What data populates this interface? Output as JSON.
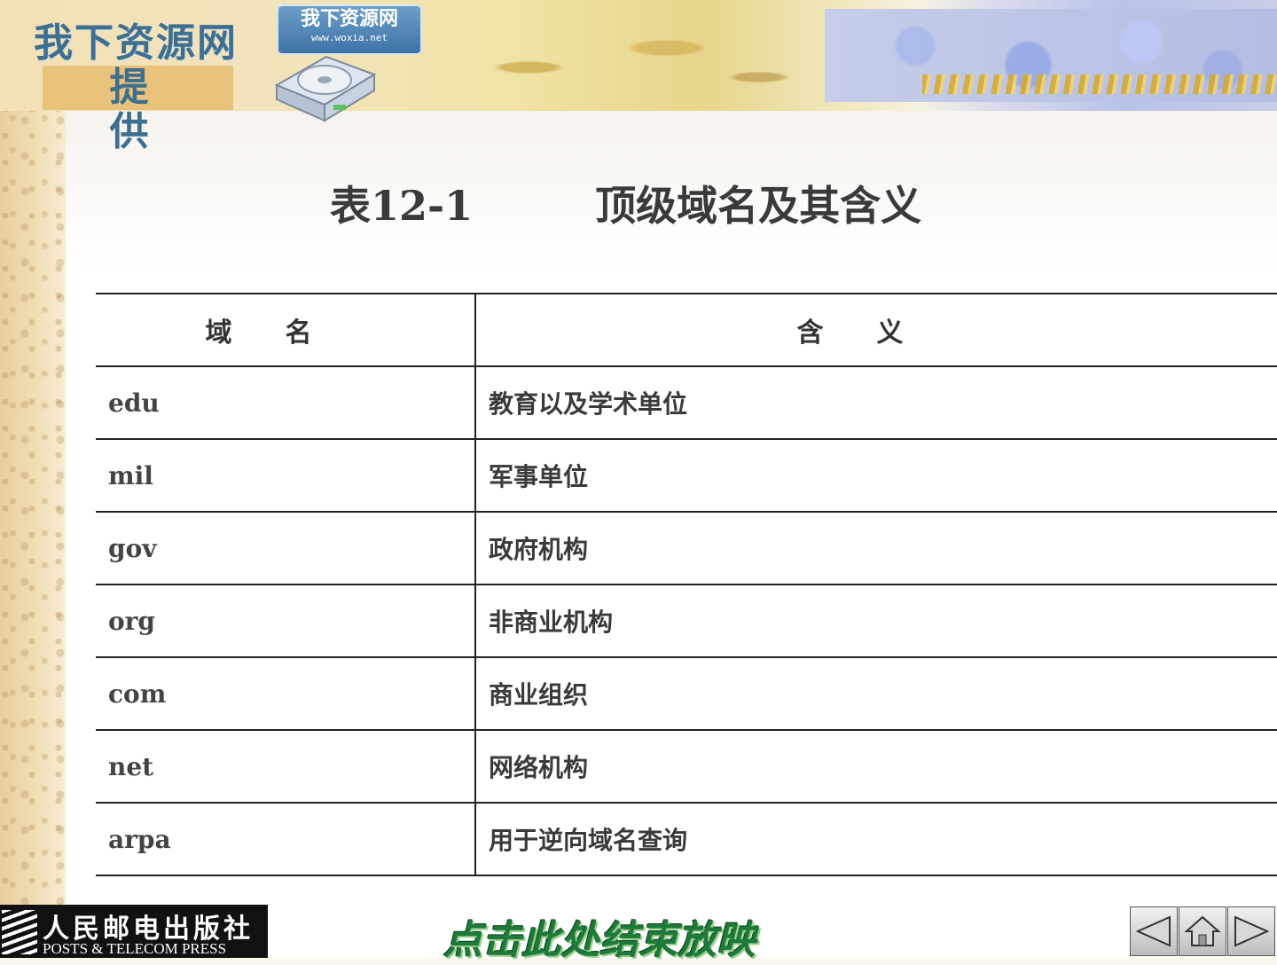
{
  "header": {
    "site_name": "我下资源网",
    "provide_label": "提 供",
    "logo_title": "我下资源网",
    "logo_url": "www.woxia.net"
  },
  "table": {
    "title": "表12-1　　　顶级域名及其含义",
    "headers": [
      "域名",
      "含义"
    ],
    "rows": [
      {
        "domain": "edu",
        "meaning": "教育以及学术单位"
      },
      {
        "domain": "mil",
        "meaning": "军事单位"
      },
      {
        "domain": "gov",
        "meaning": "政府机构"
      },
      {
        "domain": "org",
        "meaning": "非商业机构"
      },
      {
        "domain": "com",
        "meaning": "商业组织"
      },
      {
        "domain": "net",
        "meaning": "网络机构"
      },
      {
        "domain": "arpa",
        "meaning": "用于逆向域名查询"
      }
    ]
  },
  "footer": {
    "publisher_cn": "人民邮电出版社",
    "publisher_en": "POSTS & TELECOM PRESS",
    "end_show_label": "点击此处结束放映",
    "nav_icons": [
      "prev-arrow-icon",
      "home-icon",
      "next-arrow-icon"
    ]
  },
  "colors": {
    "title_text": "#3a3a3a",
    "end_show_green": "#1e7a3a",
    "site_name_blue": "#3f6f8f"
  }
}
